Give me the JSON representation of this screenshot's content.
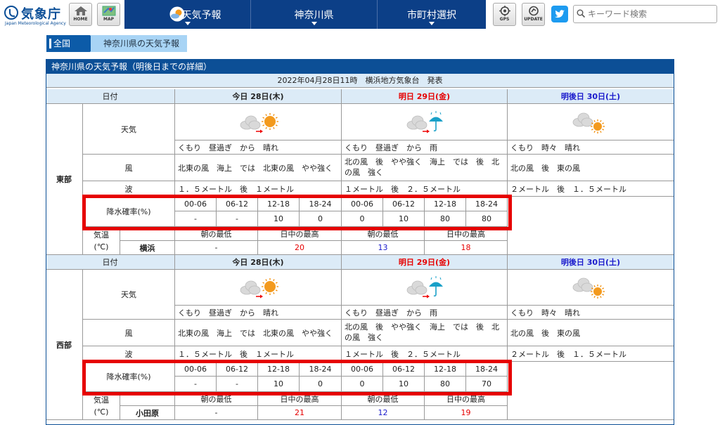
{
  "header": {
    "logo_title": "気象庁",
    "logo_sub": "Japan Meteorological Agency",
    "home_label": "HOME",
    "map_label": "MAP",
    "nav": [
      {
        "label": "天気予報"
      },
      {
        "label": "神奈川県"
      },
      {
        "label": "市町村選択"
      }
    ],
    "gps_label": "GPS",
    "update_label": "UPDATE",
    "search_placeholder": "キーワード検索"
  },
  "breadcrumb": {
    "root": "全国",
    "current": "神奈川県の天気予報"
  },
  "panel": {
    "title": "神奈川県の天気予報（明後日までの詳細）",
    "issued": "2022年04月28日11時　横浜地方気象台　発表"
  },
  "labels": {
    "date": "日付",
    "weather": "天気",
    "wind": "風",
    "wave": "波",
    "pop": "降水確率(%)",
    "temp_line1": "気温",
    "temp_line2": "(℃)",
    "min": "朝の最低",
    "max": "日中の最高"
  },
  "days": [
    "今日 28日(木)",
    "明日 29日(金)",
    "明後日 30日(土)"
  ],
  "pop_times": [
    "00-06",
    "06-12",
    "12-18",
    "18-24"
  ],
  "regions": [
    {
      "name": "東部",
      "weather": [
        "くもり　昼過ぎ　から　晴れ",
        "くもり　昼過ぎ　から　雨",
        "くもり　時々　晴れ"
      ],
      "wind": [
        "北東の風　海上　では　北東の風　やや強く",
        "北の風　後　やや強く　海上　では　後　北の風　強く",
        "北の風　後　東の風"
      ],
      "wind_b": [
        "北の風　後　やや強く　海上　では　後　北",
        "の風　強く"
      ],
      "wave": [
        "１．５メートル　後　１メートル",
        "１メートル　後　２．５メートル",
        "２メートル　後　１．５メートル"
      ],
      "pop_today": [
        "-",
        "-",
        "10",
        "0"
      ],
      "pop_tomorrow": [
        "0",
        "10",
        "80",
        "80"
      ],
      "city": "横浜",
      "temps": [
        "-",
        "20",
        "13",
        "18"
      ]
    },
    {
      "name": "西部",
      "weather": [
        "くもり　昼過ぎ　から　晴れ",
        "くもり　昼過ぎ　から　雨",
        "くもり　時々　晴れ"
      ],
      "wind": [
        "北東の風　海上　では　北東の風　やや強く",
        "北の風　後　やや強く　海上　では　後　北の風　強く",
        "北の風　後　東の風"
      ],
      "wind_b": [
        "北の風　後　やや強く　海上　では　後　北",
        "の風　強く"
      ],
      "wave": [
        "１．５メートル　後　１メートル",
        "１メートル　後　２．５メートル",
        "２メートル　後　１．５メートル"
      ],
      "pop_today": [
        "-",
        "-",
        "10",
        "0"
      ],
      "pop_tomorrow": [
        "0",
        "10",
        "80",
        "70"
      ],
      "city": "小田原",
      "temps": [
        "-",
        "21",
        "12",
        "19"
      ]
    }
  ],
  "colors": {
    "nav_bg": "#0c3f87",
    "panel_title_bg": "#0c4f96",
    "header_bg": "#dcebf7",
    "highlight": "#e60000",
    "tomorrow": "#e60000",
    "dayafter": "#1a1acc"
  },
  "icons": {
    "weather": [
      "cloudy-then-sunny-icon",
      "cloudy-then-rain-icon",
      "cloudy-sometimes-sunny-icon"
    ]
  }
}
